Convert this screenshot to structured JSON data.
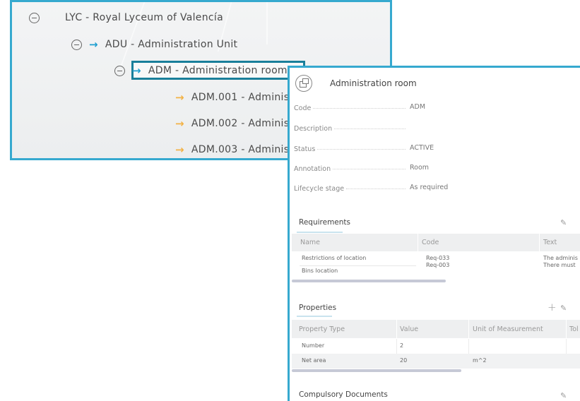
{
  "tree": {
    "items": [
      {
        "label": "LYC - Royal Lyceum of Valencía"
      },
      {
        "label": "ADU - Administration Unit"
      },
      {
        "label": "ADM - Administration room"
      },
      {
        "label": "ADM.001 - Adminis"
      },
      {
        "label": "ADM.002 - Adminis"
      },
      {
        "label": "ADM.003 - Adminis"
      }
    ],
    "colors": {
      "accent": "#36a9cf",
      "arrow_blue": "#1f9fd0",
      "arrow_orange": "#f3b246",
      "selected_border": "#1a7f9a"
    }
  },
  "detail": {
    "title": "Administration room",
    "fields": [
      {
        "label": "Code",
        "value": "ADM"
      },
      {
        "label": "Description",
        "value": ""
      },
      {
        "label": "Status",
        "value": "ACTIVE"
      },
      {
        "label": "Annotation",
        "value": "Room"
      },
      {
        "label": "Lifecycle stage",
        "value": "As required"
      }
    ],
    "requirements": {
      "title": "Requirements",
      "columns": [
        "Name",
        "Code",
        "Text"
      ],
      "rows": [
        {
          "name": "Restrictions of location",
          "code": "Req-033",
          "text": "The adminis"
        },
        {
          "name": "Bins location",
          "code": "Req-003",
          "text": "There must"
        }
      ]
    },
    "properties": {
      "title": "Properties",
      "columns": [
        "Property Type",
        "Value",
        "Unit of Measurement",
        "Tol"
      ],
      "rows": [
        {
          "type": "Number",
          "value": "2",
          "unit": ""
        },
        {
          "type": "Net area",
          "value": "20",
          "unit": "m^2"
        }
      ]
    },
    "documents": {
      "title": "Compulsory Documents"
    }
  },
  "icons": {
    "collapse": "minus-circle-icon",
    "arrow": "arrow-right-icon",
    "room": "room-icon",
    "edit": "pencil-icon",
    "add": "plus-icon"
  }
}
